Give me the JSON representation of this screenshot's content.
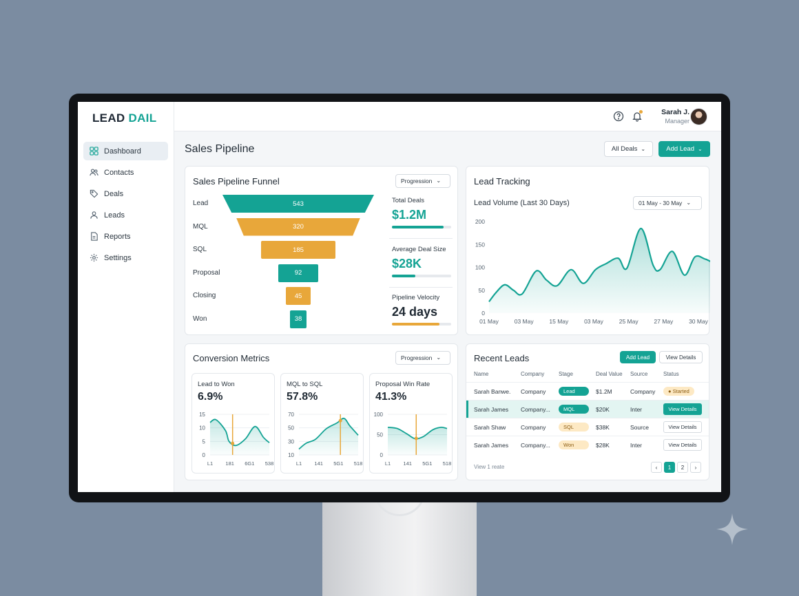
{
  "brand": {
    "part1": "LEAD",
    "part2": "DAIL"
  },
  "sidebar": {
    "items": [
      {
        "label": "Dashboard",
        "icon": "grid-icon"
      },
      {
        "label": "Contacts",
        "icon": "users-icon"
      },
      {
        "label": "Deals",
        "icon": "tag-icon"
      },
      {
        "label": "Leads",
        "icon": "user-icon"
      },
      {
        "label": "Reports",
        "icon": "file-icon"
      },
      {
        "label": "Settings",
        "icon": "gear-icon"
      }
    ]
  },
  "header": {
    "user_name": "Sarah J.",
    "user_role": "Manager"
  },
  "page": {
    "title": "Sales Pipeline",
    "filter_label": "All Deals",
    "add_lead_label": "Add Lead"
  },
  "funnel_card": {
    "title": "Sales Pipeline Funnel",
    "select": "Progression",
    "stages": [
      {
        "label": "Lead",
        "value": "543",
        "color": "#14a394"
      },
      {
        "label": "MQL",
        "value": "320",
        "color": "#e8a73a"
      },
      {
        "label": "SQL",
        "value": "185",
        "color": "#e8a73a"
      },
      {
        "label": "Proposal",
        "value": "92",
        "color": "#14a394"
      },
      {
        "label": "Closing",
        "value": "45",
        "color": "#e8a73a"
      },
      {
        "label": "Won",
        "value": "38",
        "color": "#14a394"
      }
    ],
    "metrics": [
      {
        "label": "Total Deals",
        "value": "$1.2M",
        "progress": 0.87,
        "color": "#14a394"
      },
      {
        "label": "Average Deal Size",
        "value": "$28K",
        "progress": 0.4,
        "color": "#14a394"
      },
      {
        "label": "Pipeline Velocity",
        "value": "24 days",
        "progress": 0.8,
        "color": "#e8a73a"
      }
    ]
  },
  "lead_tracking": {
    "title": "Lead Tracking",
    "subtitle": "Lead Volume (Last 30 Days)",
    "date_range": "01 May - 30 May"
  },
  "chart_data": {
    "type": "area",
    "title": "Lead Volume (Last 30 Days)",
    "x": [
      "01 May",
      "03 May",
      "15 May",
      "03 May",
      "25 May",
      "27 May",
      "30 May"
    ],
    "ylim": [
      0,
      200
    ],
    "yticks": [
      0,
      50,
      100,
      150,
      200
    ],
    "series": [
      {
        "color": "#14a394",
        "points": [
          [
            0,
            25
          ],
          [
            0.2,
            45
          ],
          [
            0.45,
            62
          ],
          [
            0.7,
            50
          ],
          [
            0.95,
            42
          ],
          [
            1.35,
            92
          ],
          [
            1.65,
            72
          ],
          [
            1.95,
            60
          ],
          [
            2.35,
            95
          ],
          [
            2.7,
            65
          ],
          [
            3.05,
            95
          ],
          [
            3.35,
            108
          ],
          [
            3.7,
            120
          ],
          [
            3.95,
            98
          ],
          [
            4.35,
            185
          ],
          [
            4.7,
            105
          ],
          [
            4.9,
            95
          ],
          [
            5.25,
            135
          ],
          [
            5.6,
            83
          ],
          [
            5.9,
            123
          ],
          [
            6.2,
            118
          ],
          [
            6.5,
            112
          ],
          [
            6.85,
            140
          ],
          [
            7.0,
            180
          ]
        ]
      }
    ]
  },
  "conversion": {
    "title": "Conversion Metrics",
    "select": "Progression",
    "cards": [
      {
        "title": "Lead to Won",
        "value": "6.9%",
        "yticks": [
          "15",
          "10",
          "5",
          "0"
        ],
        "xticks": [
          "L1",
          "181",
          "6G1",
          "538"
        ],
        "ymax": 15,
        "points": [
          [
            0,
            12
          ],
          [
            0.5,
            13
          ],
          [
            1.3,
            9
          ],
          [
            1.6,
            5
          ],
          [
            2.2,
            3.5
          ],
          [
            3.0,
            6
          ],
          [
            3.8,
            10.5
          ],
          [
            4.5,
            6.5
          ],
          [
            5.0,
            4.5
          ]
        ],
        "marker": 1.9
      },
      {
        "title": "MQL to SQL",
        "value": "57.8%",
        "yticks": [
          "70",
          "50",
          "30",
          "10"
        ],
        "xticks": [
          "L1",
          "141",
          "5G1",
          "518"
        ],
        "ymax": 70,
        "points": [
          [
            0,
            10
          ],
          [
            0.6,
            20
          ],
          [
            1.4,
            27
          ],
          [
            2.3,
            45
          ],
          [
            3.2,
            55
          ],
          [
            3.8,
            63
          ],
          [
            4.3,
            50
          ],
          [
            5.0,
            34
          ]
        ],
        "marker": 3.5
      },
      {
        "title": "Proposal Win Rate",
        "value": "41.3%",
        "yticks": [
          "100",
          "50",
          "0"
        ],
        "xticks": [
          "L1",
          "141",
          "5G1",
          "518"
        ],
        "ymax": 100,
        "points": [
          [
            0,
            68
          ],
          [
            0.8,
            65
          ],
          [
            1.6,
            52
          ],
          [
            2.3,
            40
          ],
          [
            3.0,
            45
          ],
          [
            3.8,
            62
          ],
          [
            4.5,
            68
          ],
          [
            5.0,
            65
          ]
        ],
        "marker": 2.4
      }
    ]
  },
  "recent_leads": {
    "title": "Recent Leads",
    "add_label": "Add Lead",
    "view_label": "View Details",
    "columns": [
      "Name",
      "Company",
      "Stage",
      "Deal Value",
      "Source",
      "Status"
    ],
    "rows": [
      {
        "name": "Sarah Banwe.",
        "company": "Company",
        "stage": "Lead",
        "value": "$1.2M",
        "source": "Company",
        "status": "Started",
        "status_type": "badge"
      },
      {
        "name": "Sarah James",
        "company": "Company...",
        "stage": "MQL",
        "value": "$20K",
        "source": "Inter",
        "status": "View Details",
        "status_type": "primary"
      },
      {
        "name": "Sarah Shaw",
        "company": "Company",
        "stage": "SQL",
        "value": "$38K",
        "source": "Source",
        "status": "View Details",
        "status_type": "outline"
      },
      {
        "name": "Sarah James",
        "company": "Company...",
        "stage": "Won",
        "value": "$28K",
        "source": "Inter",
        "status": "View Details",
        "status_type": "outline"
      }
    ],
    "footer": "View 1 reate",
    "pages": [
      "1",
      "2"
    ]
  }
}
